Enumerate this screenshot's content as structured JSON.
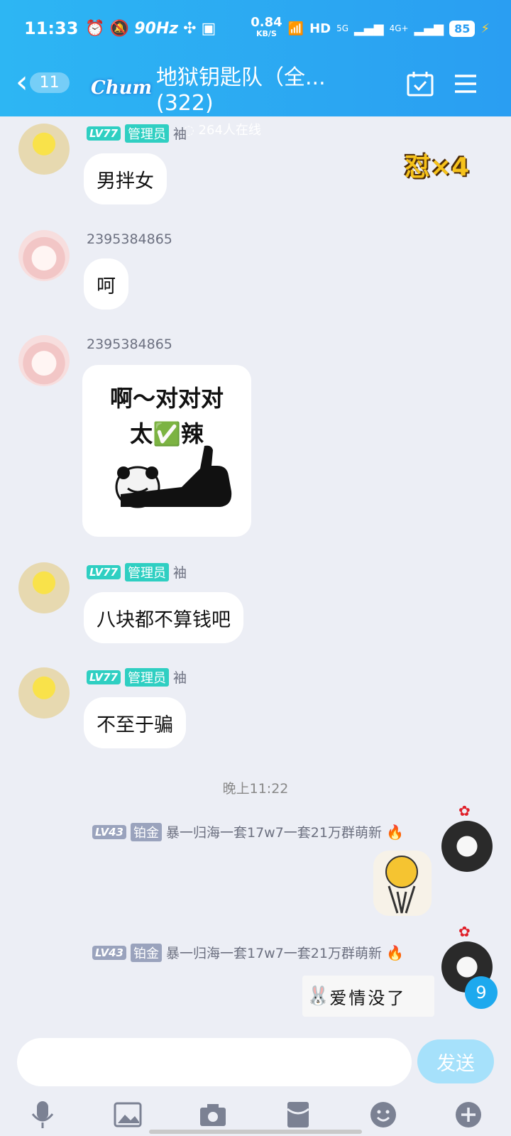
{
  "status_bar": {
    "time": "11:33",
    "hz": "90Hz",
    "speed": "0.84",
    "speed_unit": "KB/S",
    "network": "HD",
    "sig1": "5G",
    "sig2": "4G+",
    "battery": "85"
  },
  "header": {
    "back_count": "11",
    "brand": "Chum",
    "title": "地狱钥匙队（全...(322)",
    "online": "264人在线"
  },
  "overlay_badge": "怼×4",
  "messages": [
    {
      "lv": "LV77",
      "role": "管理员",
      "name": "袖",
      "text": "男拌女"
    },
    {
      "name": "2395384865",
      "text": "呵"
    },
    {
      "name": "2395384865",
      "sticker_line1": "啊～对对对",
      "sticker_line2": "太✅辣"
    },
    {
      "lv": "LV77",
      "role": "管理员",
      "name": "袖",
      "text": "八块都不算钱吧"
    },
    {
      "lv": "LV77",
      "role": "管理员",
      "name": "袖",
      "text": "不至于骗"
    }
  ],
  "time_separator": "晚上11:22",
  "outgoing": [
    {
      "lv": "LV43",
      "role": "铂金",
      "name": "暴一归海一套17w7一套21万群萌新"
    },
    {
      "lv": "LV43",
      "role": "铂金",
      "name": "暴一归海一套17w7一套21万群萌新",
      "sticker_text": "爱情没了"
    }
  ],
  "unread_badge": "9",
  "composer": {
    "send_label": "发送"
  },
  "colors": {
    "header": "#2aa8f2",
    "admin_tag": "#2fcfc2",
    "grey_tag": "#9aa3bd",
    "send": "#a6e1fb"
  }
}
